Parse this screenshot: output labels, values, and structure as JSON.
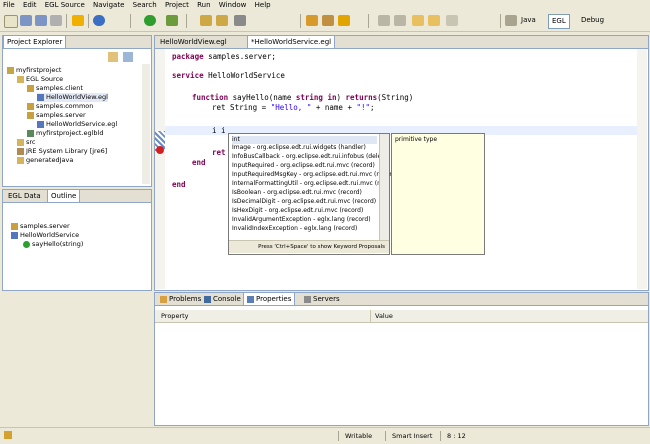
{
  "menu": [
    "File",
    "Edit",
    "EGL Source",
    "Navigate",
    "Search",
    "Project",
    "Run",
    "Window",
    "Help"
  ],
  "perspectives": {
    "java": "Java",
    "egl": "EGL",
    "debug": "Debug"
  },
  "project_explorer": {
    "title": "Project Explorer",
    "items": [
      "myfirstproject",
      "EGL Source",
      "samples.client",
      "HelloWorldView.egl",
      "samples.common",
      "samples.server",
      "HelloWorldService.egl",
      "myfirstproject.eglbld",
      "src",
      "JRE System Library [jre6]",
      "generatedJava"
    ]
  },
  "outline": {
    "tabs": [
      "EGL Data",
      "Outline"
    ],
    "items": [
      "samples.server",
      "HelloWorldService",
      "sayHello(string)"
    ]
  },
  "editor": {
    "tabs": [
      "HelloWorldView.egl",
      "*HelloWorldService.egl"
    ],
    "lines": {
      "l1_kw": "package",
      "l1_rest": " samples.server;",
      "l2_kw": "service",
      "l2_rest": " HelloWorldService",
      "l3_kw": "function",
      "l3_a": " sayHello(name ",
      "l3_kw2": "string in",
      "l3_b": ") ",
      "l3_kw3": "returns",
      "l3_c": "(String)",
      "l4_a": "ret String = ",
      "l4_str": "\"Hello, \"",
      "l4_b": " + name + ",
      "l4_str2": "\"!\"",
      "l4_c": ";",
      "l5": "i i",
      "l6_kw": "ret",
      "l7_kw": "end",
      "l8_kw": "end"
    }
  },
  "content_assist": {
    "items": [
      "int",
      "Image - org.eclipse.edt.rui.widgets (handler)",
      "InfoBusCallback - org.eclipse.edt.rui.infobus (dele",
      "InputRequired - org.eclipse.edt.rui.mvc (record)",
      "InputRequiredMsgKey - org.eclipse.edt.rui.mvc (record)",
      "InternalFormattingUtil - org.eclipse.edt.rui.mvc (r",
      "IsBoolean - org.eclipse.edt.rui.mvc (record)",
      "IsDecimalDigit - org.eclipse.edt.rui.mvc (record)",
      "IsHexDigit - org.eclipse.edt.rui.mvc (record)",
      "InvalidArgumentException - eglx.lang (record)",
      "InvalidIndexException - eglx.lang (record)"
    ],
    "hint": "Press 'Ctrl+Space' to show Keyword Proposals",
    "doc": "primitive type"
  },
  "bottom": {
    "tabs": [
      "Problems",
      "Console",
      "Properties",
      "Servers"
    ],
    "columns": [
      "Property",
      "Value"
    ]
  },
  "status": {
    "writable": "Writable",
    "insert": "Smart Insert",
    "position": "8 : 12"
  }
}
